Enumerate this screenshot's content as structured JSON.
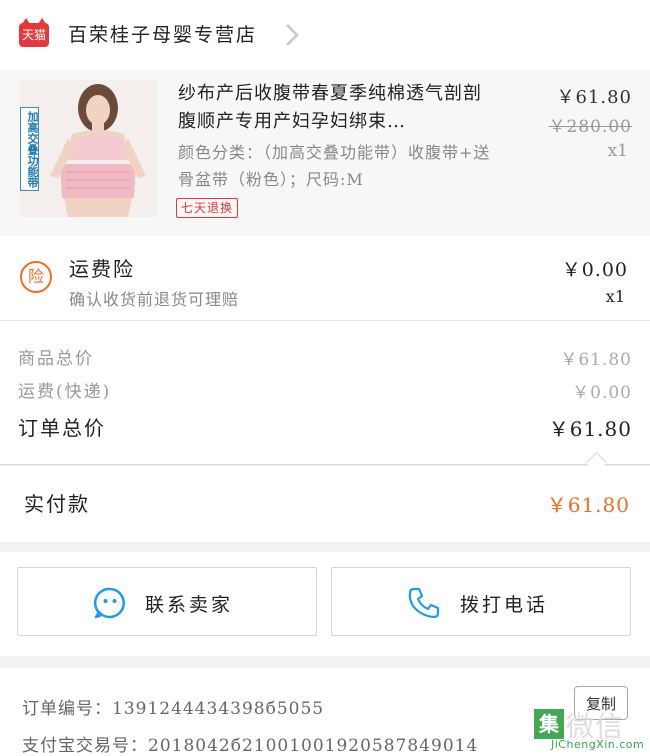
{
  "store": {
    "badge": "天猫",
    "name": "百荣桂子母婴专营店",
    "chevron_icon": "chevron-right-icon"
  },
  "product": {
    "image_tag": "加高交叠功能带",
    "title": "纱布产后收腹带春夏季纯棉透气剖剖腹顺产专用产妇孕妇绑束…",
    "sku": "颜色分类：（加高交叠功能带）收腹带+送骨盆带（粉色）；尺码:M",
    "badge": "七天退换",
    "price": "￥61.80",
    "original_price": "￥280.00",
    "quantity": "x1"
  },
  "insurance": {
    "icon_label": "险",
    "name": "运费险",
    "description": "确认收货前退货可理赔",
    "price": "￥0.00",
    "quantity": "x1"
  },
  "totals": {
    "goods_label": "商品总价",
    "goods_value": "￥61.80",
    "shipping_label": "运费(快递)",
    "shipping_value": "￥0.00",
    "order_label": "订单总价",
    "order_value": "￥61.80"
  },
  "payment": {
    "label": "实付款",
    "value": "￥61.80",
    "accent_color": "#f06d2b"
  },
  "actions": {
    "contact_label": "联系卖家",
    "contact_icon": "chat-bubble-icon",
    "call_label": "拨打电话",
    "call_icon": "phone-icon",
    "icon_color": "#1e9be8"
  },
  "order_info": {
    "order_number": "订单编号：1391244434398б5055",
    "copy_label": "复制",
    "alipay_number": "支付宝交易号：2018042б21001001920587849014"
  },
  "watermark": {
    "logo_char": "集",
    "text": "微信",
    "url": "JiChengXin.com"
  }
}
